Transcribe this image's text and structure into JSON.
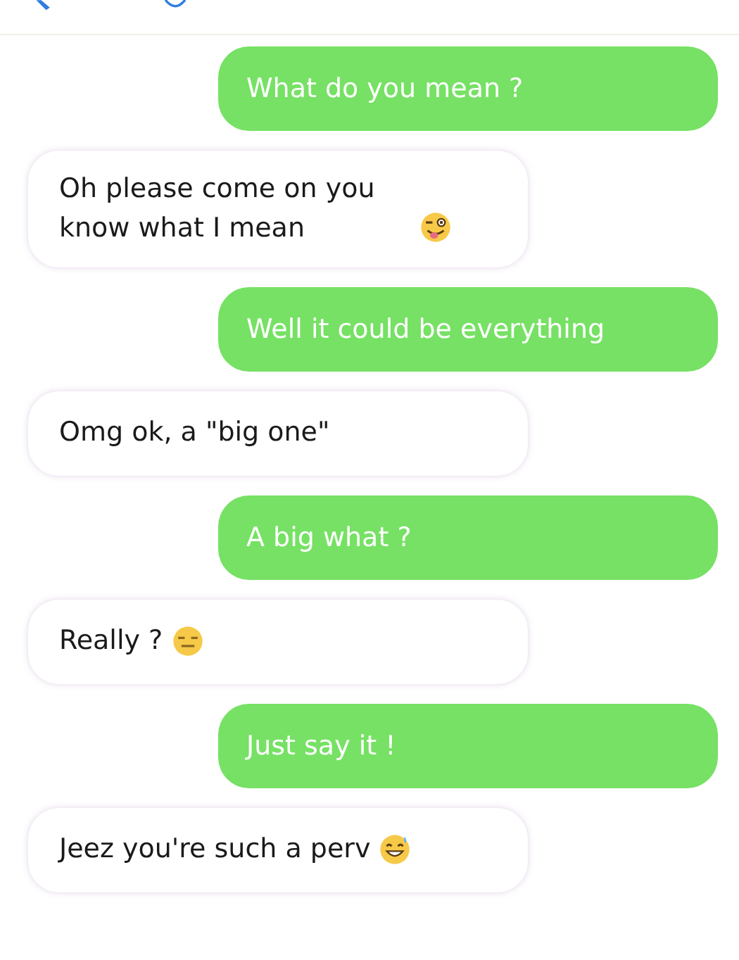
{
  "messages": [
    {
      "kind": "sent",
      "text": "What do you mean ?"
    },
    {
      "kind": "received",
      "text": "Oh please come on you know what I mean",
      "emoji": {
        "kind": "wink"
      }
    },
    {
      "kind": "sent",
      "text": "Well it could be everything"
    },
    {
      "kind": "received",
      "text": "Omg ok, a \"big one\""
    },
    {
      "kind": "sent",
      "text": "A big what ?"
    },
    {
      "kind": "received",
      "text": "Really ?",
      "emoji": {
        "kind": "flat"
      }
    },
    {
      "kind": "sent",
      "text": "Just say it !"
    },
    {
      "kind": "received",
      "text": "Jeez you're such a perv",
      "emoji": {
        "kind": "sweat"
      }
    }
  ]
}
